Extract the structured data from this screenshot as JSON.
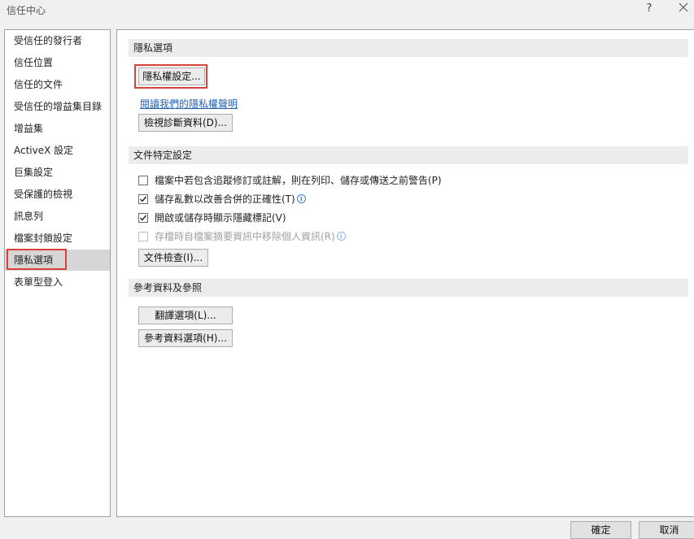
{
  "window": {
    "title": "信任中心",
    "help_label": "?"
  },
  "sidebar": {
    "items": [
      {
        "label": "受信任的發行者"
      },
      {
        "label": "信任位置"
      },
      {
        "label": "信任的文件"
      },
      {
        "label": "受信任的增益集目錄"
      },
      {
        "label": "增益集"
      },
      {
        "label": "ActiveX 設定"
      },
      {
        "label": "巨集設定"
      },
      {
        "label": "受保護的檢視"
      },
      {
        "label": "訊息列"
      },
      {
        "label": "檔案封鎖設定"
      },
      {
        "label": "隱私選項",
        "selected": true
      },
      {
        "label": "表單型登入"
      }
    ]
  },
  "privacy": {
    "header": "隱私選項",
    "settings_button": "隱私權設定...",
    "statement_link": "閱讀我們的隱私權聲明",
    "diagnostics_button": "檢視診斷資料(D)..."
  },
  "document": {
    "header": "文件特定設定",
    "options": [
      {
        "label": "檔案中若包含追蹤修訂或註解，則在列印、儲存或傳送之前警告(P)",
        "checked": false,
        "disabled": false,
        "info": false
      },
      {
        "label": "儲存亂數以改善合併的正確性(T)",
        "checked": true,
        "disabled": false,
        "info": true
      },
      {
        "label": "開啟或儲存時顯示隱藏標記(V)",
        "checked": true,
        "disabled": false,
        "info": false
      },
      {
        "label": "存檔時自檔案摘要資訊中移除個人資訊(R)",
        "checked": false,
        "disabled": true,
        "info": true
      }
    ],
    "inspect_button": "文件檢查(I)..."
  },
  "reference": {
    "header": "參考資料及參照",
    "translation_button": "翻譯選項(L)...",
    "research_button": "參考資料選項(H)..."
  },
  "footer": {
    "ok_label": "確定",
    "cancel_label": "取消"
  },
  "colors": {
    "highlight_red": "#d9413a",
    "link_blue": "#2260b7",
    "selected_bg": "#d6d6d6"
  }
}
